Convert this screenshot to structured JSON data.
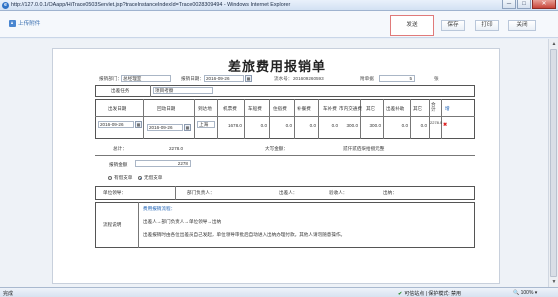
{
  "window": {
    "title": "http://127.0.0.1/OAapp/HiTrace0503Servlet.jsp?traceInstanceIndexId=Trace0028309494 - Windows Internet Explorer",
    "minimize": "─",
    "maximize": "□",
    "close": "✕"
  },
  "toolbar": {
    "upload_label": "上传附件",
    "send_label": "发送",
    "save_label": "保存",
    "print_label": "打印",
    "close_label": "关闭"
  },
  "form": {
    "title": "差旅费用报销单",
    "dept_label": "报销部门：",
    "dept_value": "总经理室",
    "date_label": "报销日期：",
    "date_value": "2016-09-26",
    "flow_label": "流水号：",
    "flow_value": "201609260593",
    "attach_label": "附单据",
    "attach_value": "5",
    "attach_unit": "张",
    "task_label": "出差任务",
    "task_value": "项目考察",
    "table_headers": {
      "date_out": "出发日期",
      "date_back": "回动日期",
      "place": "到达地",
      "plane": "机票费",
      "train": "车船费",
      "hotel": "住宿费",
      "meal": "补餐费",
      "taxi": "车补费",
      "city": "市内交通费",
      "other": "其它",
      "allow": "出差补助",
      "misc": "其它",
      "total": "合计"
    },
    "row": {
      "date_out": "2016-09-26",
      "date_back": "2016-09-26",
      "place": "上海",
      "plane": "1678.0",
      "train": "0.0",
      "hotel": "0.0",
      "meal": "0.0",
      "taxi": "0.0",
      "city": "300.0",
      "other": "300.0",
      "allow": "0.0",
      "misc": "0.0",
      "total": "2278.0"
    },
    "add_label": "增",
    "delete_icon": "delete-icon",
    "sum_label": "总计：",
    "sum_value": "2278.0",
    "upper_label": "大写金额：",
    "upper_value": "贰仟贰佰柒拾捌元整",
    "reimb_label": "报销金额",
    "reimb_value": "2278",
    "radio_yes": "有借支单",
    "radio_no": "无借支单",
    "sign_dept": "单位领导：",
    "sign_mgr": "部门负责人：",
    "sign_person": "出差人：",
    "sign_verify": "验收人：",
    "sign_cashier": "出纳：",
    "flow_desc_label": "流程说明",
    "flow_desc_title": "费用报销流程：",
    "flow_desc_line1": "出差人→部门负责人→单位领导→出纳",
    "flow_desc_line2": "出差报销时由各位出差员自己发起，单位领导审批后自动进入出纳办理付款。其他人请勿随意操作。"
  },
  "status": {
    "done": "完成",
    "zone": "可信站点 | 保护模式: 禁用",
    "zoom": "100%"
  },
  "colors": {
    "accent": "#3a6fb0",
    "send_border": "#e07a7a"
  }
}
